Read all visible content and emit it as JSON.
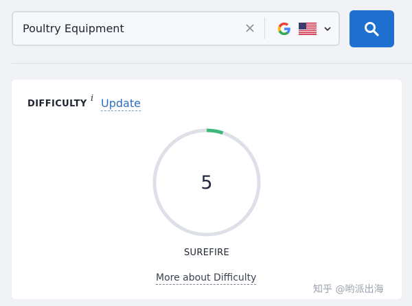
{
  "search": {
    "query": "Poultry Equipment",
    "clear_icon": "close-icon",
    "engine_icon": "google-icon",
    "country_icon": "us-flag-icon",
    "dropdown_icon": "chevron-down-icon",
    "button_icon": "search-icon",
    "button_color": "#1f6fd1"
  },
  "difficulty": {
    "label": "DIFFICULTY",
    "info_icon": "i",
    "update_link": "Update",
    "score": "5",
    "score_fraction": 0.05,
    "level_label": "SUREFIRE",
    "more_link": "More about Difficulty",
    "ring_color": "#dde0e7",
    "progress_color": "#3dba79"
  },
  "watermark": "知乎 @哟派出海"
}
